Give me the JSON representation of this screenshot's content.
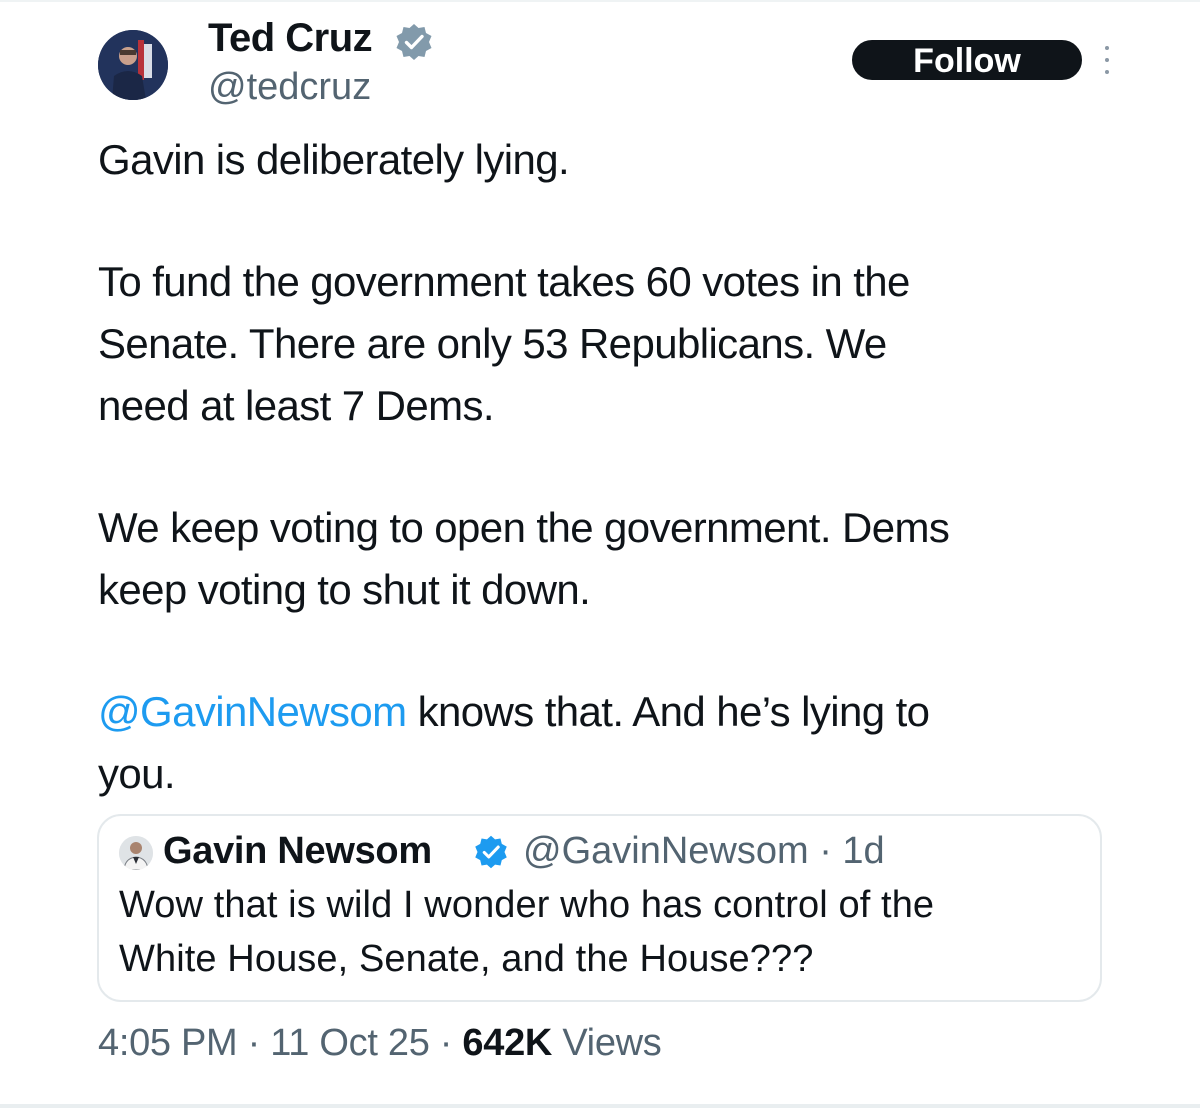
{
  "author": {
    "name": "Ted Cruz",
    "handle": "@tedcruz",
    "verified": true
  },
  "actions": {
    "follow_label": "Follow",
    "more_icon": "more-vertical-icon"
  },
  "tweet": {
    "lines": [
      "Gavin is deliberately lying.",
      "To fund the government takes 60 votes in the",
      "Senate. There are only 53 Republicans. We",
      "need at least 7 Dems.",
      "We keep voting to open the government. Dems",
      "keep voting to shut it down."
    ],
    "mention": "@GavinNewsom",
    "mention_rest": " knows that. And he’s lying to",
    "last_line": "you."
  },
  "quote": {
    "name": "Gavin Newsom",
    "verified": true,
    "handle_time": "@GavinNewsom · 1d",
    "lines": [
      "Wow that is wild I wonder who has control of the",
      "White House, Senate, and the House???"
    ]
  },
  "meta": {
    "time_date": "4:05 PM · 11 Oct 25 · ",
    "views_count": "642K",
    "views_label": " Views"
  },
  "colors": {
    "text": "#0f1419",
    "secondary": "#536471",
    "link": "#1d9bf0",
    "verified": "#829aab",
    "quote_verified": "#1d9bf0",
    "border": "#e4e9ec"
  }
}
